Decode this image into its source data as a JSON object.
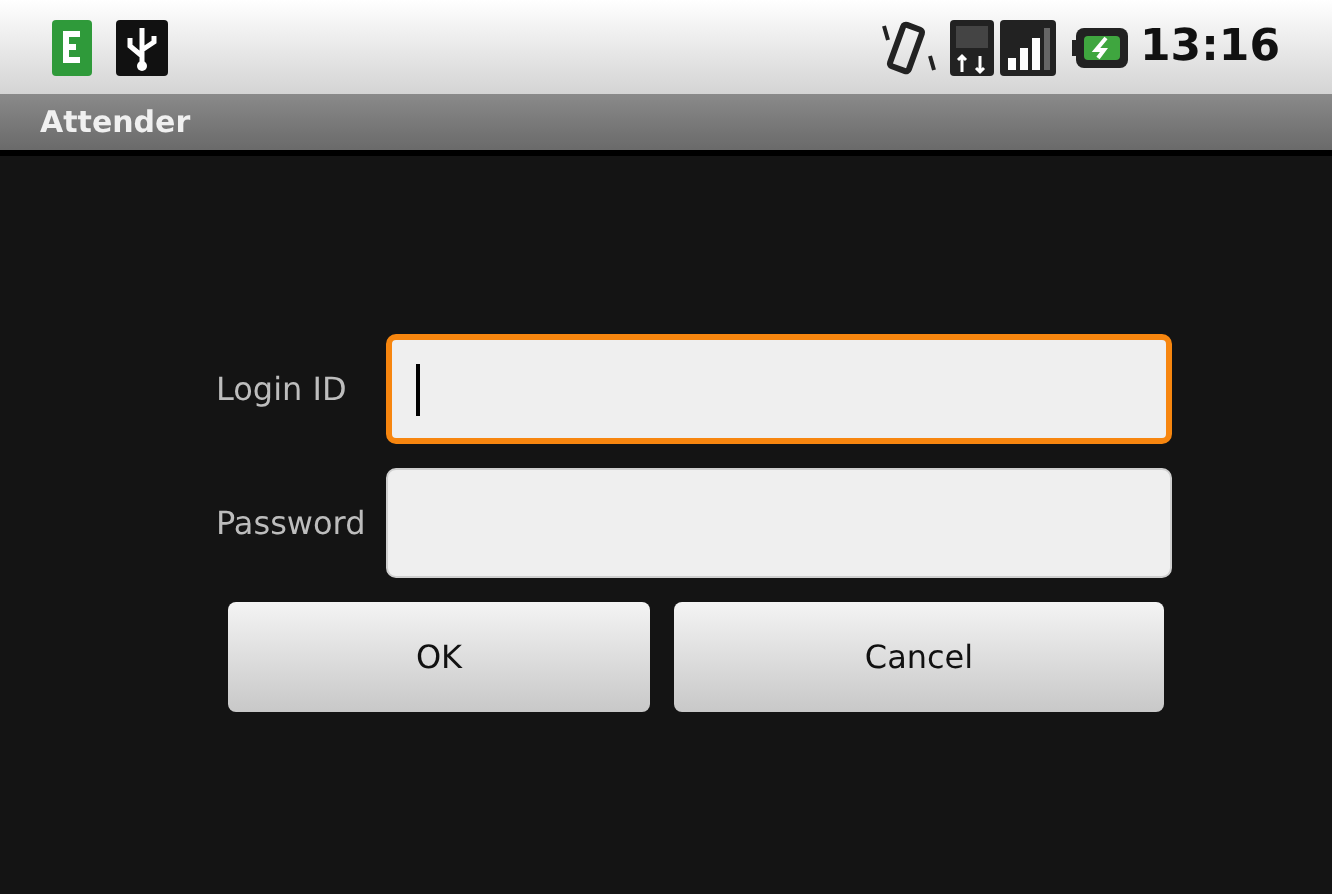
{
  "status_bar": {
    "time": "13:16"
  },
  "window": {
    "title": "Attender"
  },
  "fields": [
    {
      "label": "Login ID",
      "focused": true
    },
    {
      "label": "Password",
      "focused": false
    }
  ],
  "buttons": [
    "OK",
    "Cancel"
  ]
}
